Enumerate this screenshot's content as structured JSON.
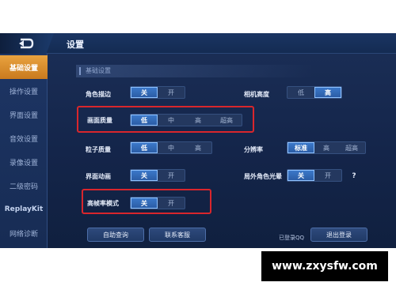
{
  "header": {
    "title": "设置"
  },
  "sidebar": {
    "items": [
      {
        "label": "基础设置",
        "active": true
      },
      {
        "label": "操作设置"
      },
      {
        "label": "界面设置"
      },
      {
        "label": "音效设置"
      },
      {
        "label": "录像设置"
      },
      {
        "label": "二级密码"
      },
      {
        "label": "ReplayKit"
      },
      {
        "label": "网络诊断"
      }
    ]
  },
  "section": {
    "title": "基础设置"
  },
  "settings": {
    "outline": {
      "label": "角色描边",
      "options": [
        "关",
        "开"
      ],
      "selected": "关"
    },
    "camera_height": {
      "label": "相机高度",
      "options": [
        "低",
        "高"
      ],
      "selected": "高"
    },
    "quality": {
      "label": "画面质量",
      "options": [
        "低",
        "中",
        "高",
        "超高"
      ],
      "selected": "低"
    },
    "particles": {
      "label": "粒子质量",
      "options": [
        "低",
        "中",
        "高"
      ],
      "selected": "低"
    },
    "resolution": {
      "label": "分辨率",
      "options": [
        "标准",
        "高",
        "超高"
      ],
      "selected": "标准"
    },
    "ui_anim": {
      "label": "界面动画",
      "options": [
        "关",
        "开"
      ],
      "selected": "关"
    },
    "halo": {
      "label": "局外角色光晕",
      "options": [
        "关",
        "开"
      ],
      "selected": "关"
    },
    "high_fps": {
      "label": "高帧率模式",
      "options": [
        "关",
        "开"
      ],
      "selected": "关"
    }
  },
  "help": {
    "symbol": "?"
  },
  "footer": {
    "self_service": "自助查询",
    "contact": "联系客服",
    "login_status": "已登录QQ",
    "logout": "退出登录"
  },
  "watermark": "www.zxysfw.com",
  "colors": {
    "highlight": "#d9262c",
    "active_tab": "#e9a33f",
    "selected": "#3b78c9"
  }
}
